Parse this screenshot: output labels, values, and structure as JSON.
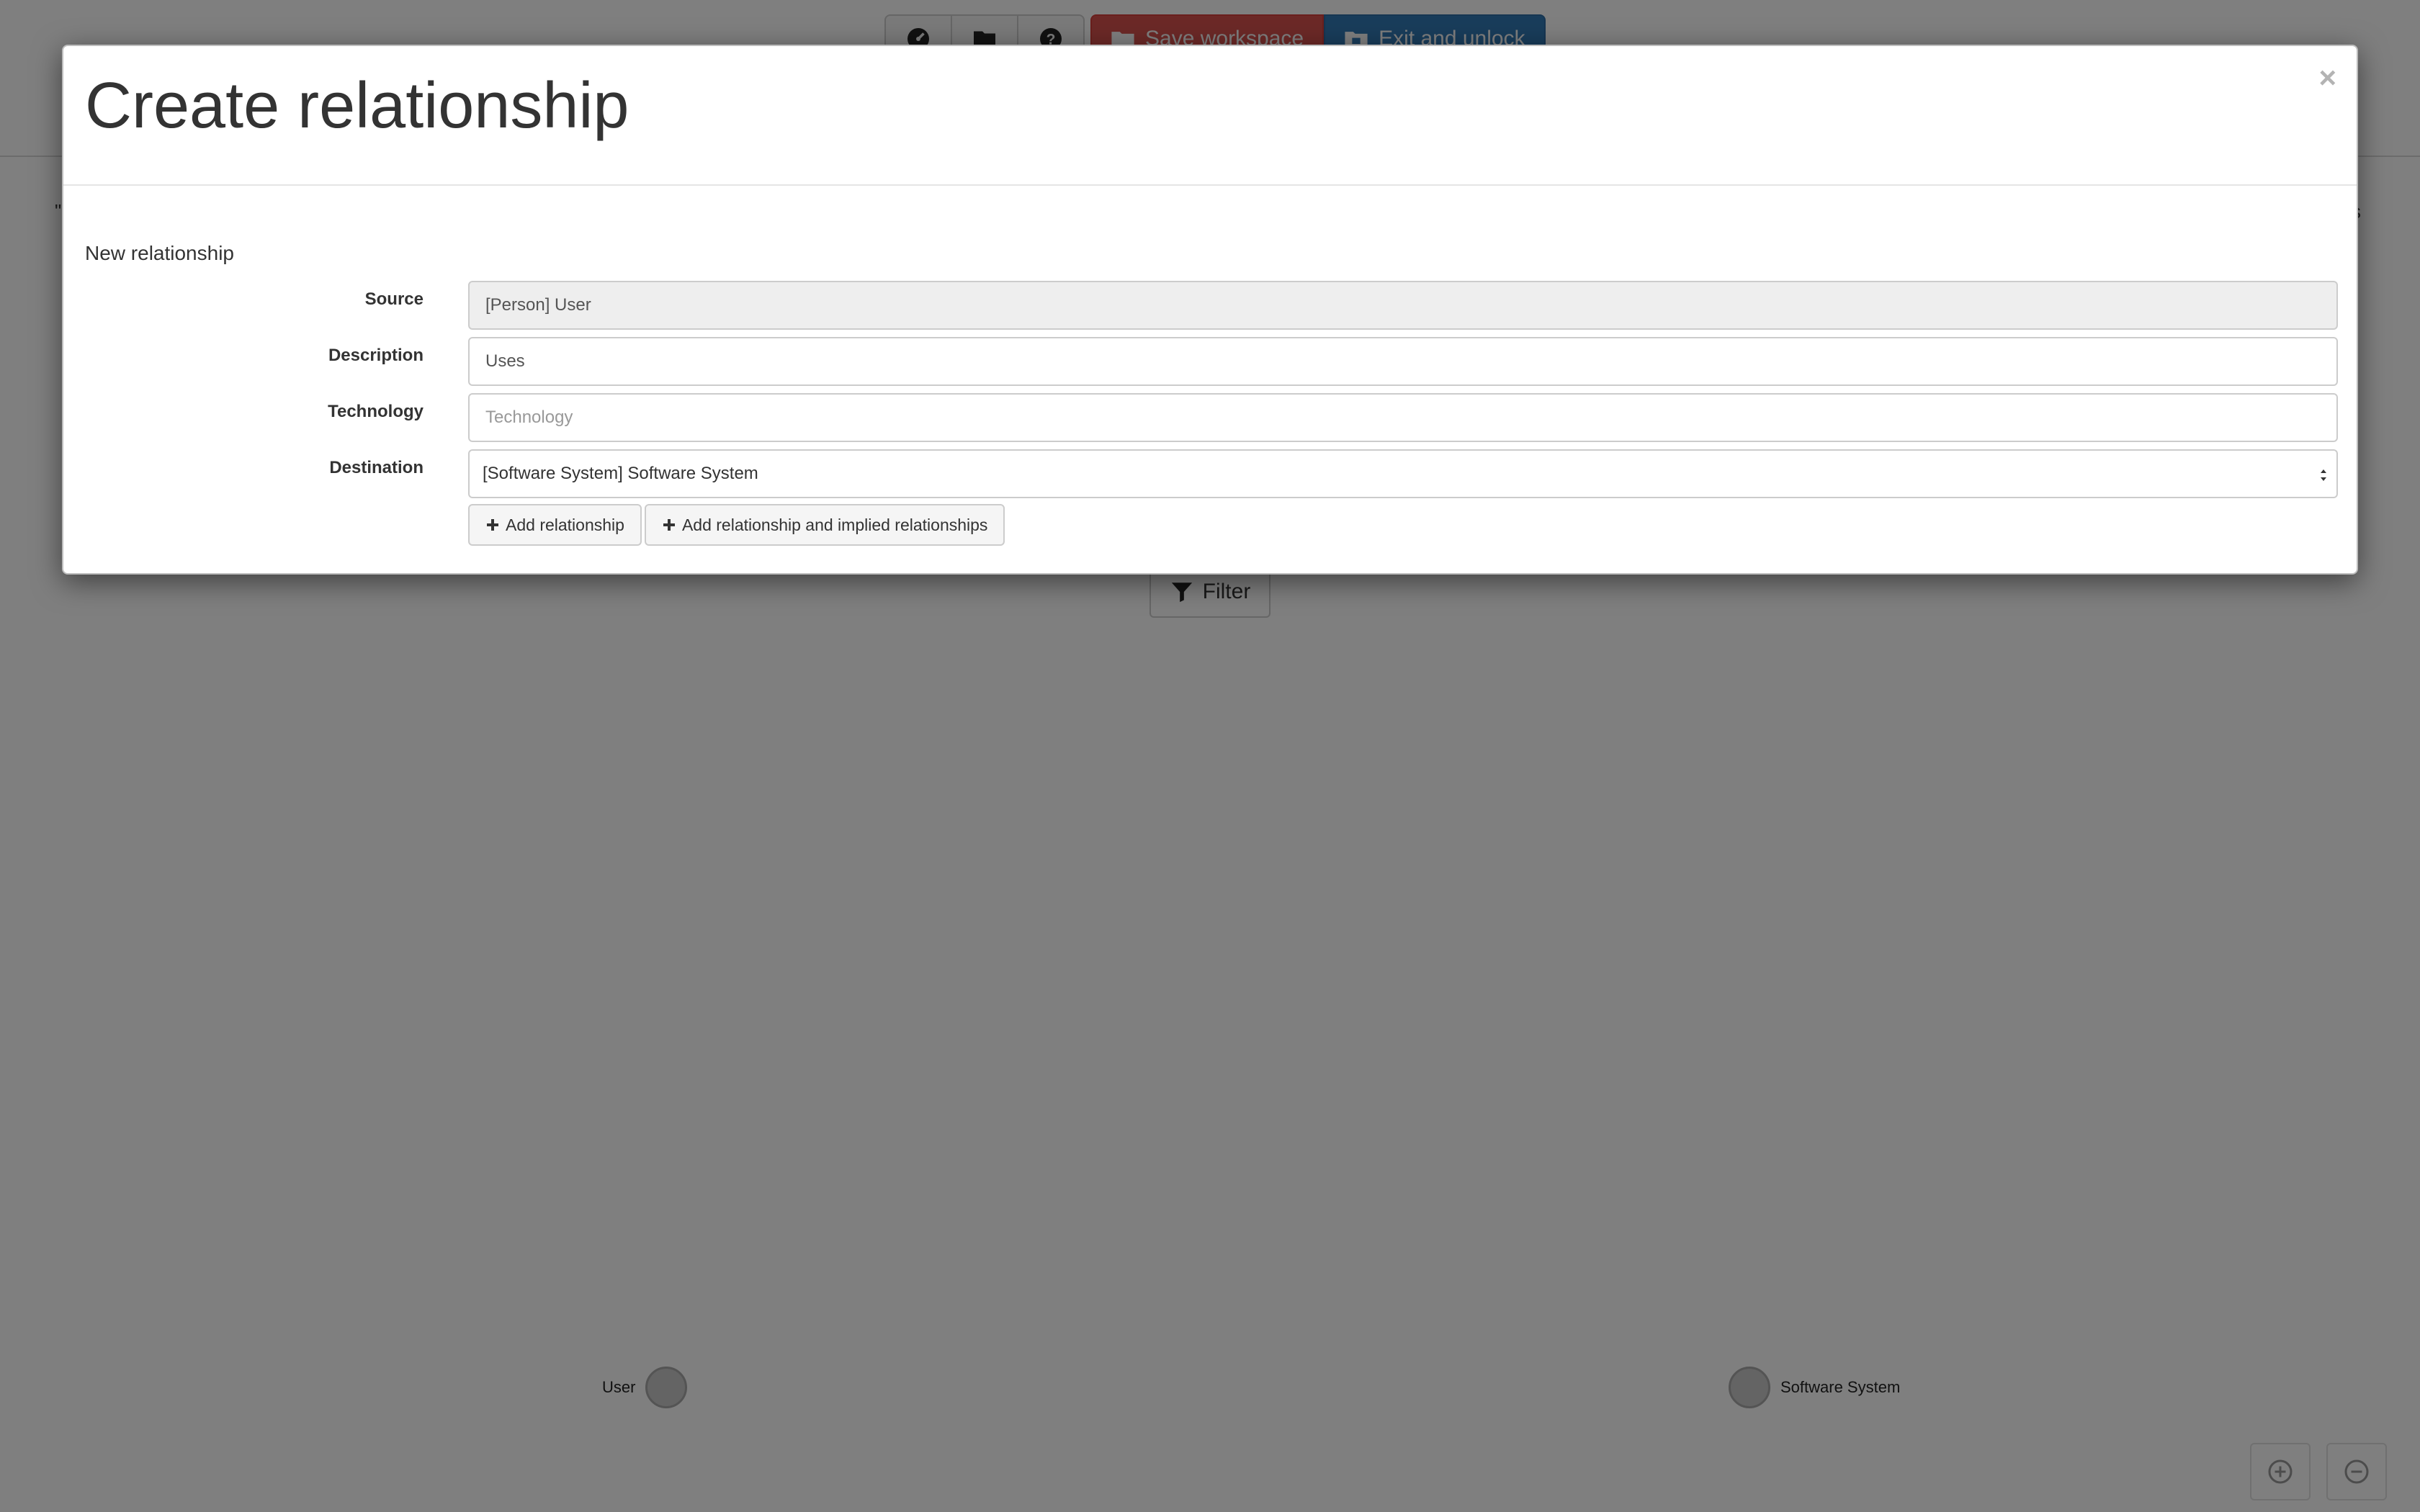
{
  "toolbar": {
    "buttons": [
      {
        "icon": "dashboard-icon"
      },
      {
        "icon": "folder-icon"
      },
      {
        "icon": "help-icon"
      }
    ],
    "save_label": "Save workspace",
    "exit_label": "Exit and unlock",
    "colors": {
      "save": "#d9534f",
      "exit": "#337ab7"
    }
  },
  "diagram": {
    "filter_label": "Filter",
    "nodes": [
      {
        "label": "User"
      },
      {
        "label": "Software System"
      }
    ],
    "zoom_in_icon": "zoom-in-icon",
    "zoom_out_icon": "zoom-out-icon"
  },
  "modal": {
    "title": "Create relationship",
    "close_symbol": "×",
    "section_title": "New relationship",
    "fields": {
      "source": {
        "label": "Source",
        "value": "[Person] User"
      },
      "description": {
        "label": "Description",
        "value": "Uses"
      },
      "technology": {
        "label": "Technology",
        "value": "",
        "placeholder": "Technology"
      },
      "destination": {
        "label": "Destination",
        "value": "[Software System] Software System"
      }
    },
    "buttons": {
      "add": "Add relationship",
      "add_implied": "Add relationship and implied relationships"
    }
  }
}
